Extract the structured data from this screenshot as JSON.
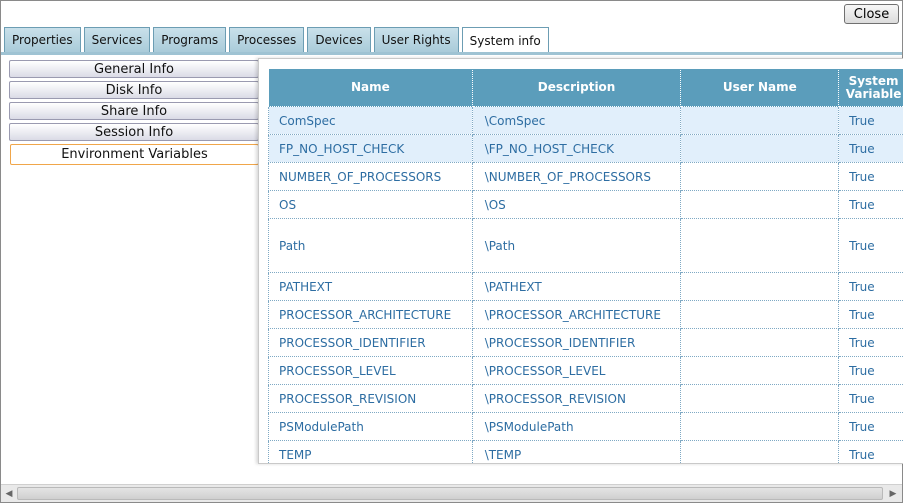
{
  "window": {
    "close_label": "Close"
  },
  "tabs": [
    {
      "label": "Properties"
    },
    {
      "label": "Services"
    },
    {
      "label": "Programs"
    },
    {
      "label": "Processes"
    },
    {
      "label": "Devices"
    },
    {
      "label": "User Rights"
    },
    {
      "label": "System info"
    }
  ],
  "active_tab": "System info",
  "left_nav": [
    {
      "label": "General Info"
    },
    {
      "label": "Disk Info"
    },
    {
      "label": "Share Info"
    },
    {
      "label": "Session Info"
    },
    {
      "label": "Environment Variables"
    }
  ],
  "selected_nav": "Environment Variables",
  "grid": {
    "columns": [
      "Name",
      "Description",
      "User Name",
      "System Variable"
    ],
    "rows": [
      {
        "name": "ComSpec",
        "description": "\\ComSpec",
        "user_name": "",
        "system_variable": "True"
      },
      {
        "name": "FP_NO_HOST_CHECK",
        "description": "\\FP_NO_HOST_CHECK",
        "user_name": "",
        "system_variable": "True"
      },
      {
        "name": "NUMBER_OF_PROCESSORS",
        "description": "\\NUMBER_OF_PROCESSORS",
        "user_name": "",
        "system_variable": "True"
      },
      {
        "name": "OS",
        "description": "\\OS",
        "user_name": "",
        "system_variable": "True"
      },
      {
        "name": "Path",
        "description": "\\Path",
        "user_name": "",
        "system_variable": "True"
      },
      {
        "name": "PATHEXT",
        "description": "\\PATHEXT",
        "user_name": "",
        "system_variable": "True"
      },
      {
        "name": "PROCESSOR_ARCHITECTURE",
        "description": "\\PROCESSOR_ARCHITECTURE",
        "user_name": "",
        "system_variable": "True"
      },
      {
        "name": "PROCESSOR_IDENTIFIER",
        "description": "\\PROCESSOR_IDENTIFIER",
        "user_name": "",
        "system_variable": "True"
      },
      {
        "name": "PROCESSOR_LEVEL",
        "description": "\\PROCESSOR_LEVEL",
        "user_name": "",
        "system_variable": "True"
      },
      {
        "name": "PROCESSOR_REVISION",
        "description": "\\PROCESSOR_REVISION",
        "user_name": "",
        "system_variable": "True"
      },
      {
        "name": "PSModulePath",
        "description": "\\PSModulePath",
        "user_name": "",
        "system_variable": "True"
      },
      {
        "name": "TEMP",
        "description": "\\TEMP",
        "user_name": "",
        "system_variable": "True"
      }
    ]
  },
  "icons": {
    "scroll_left": "scroll-left-arrow-icon",
    "scroll_right": "scroll-right-arrow-icon"
  },
  "colors": {
    "header_bg": "#5b9dbb",
    "cell_text": "#2d6da2",
    "highlight_row": "#e1effb",
    "tab_bg": "#a9cbd9",
    "selected_nav_border": "#f0a64a"
  }
}
